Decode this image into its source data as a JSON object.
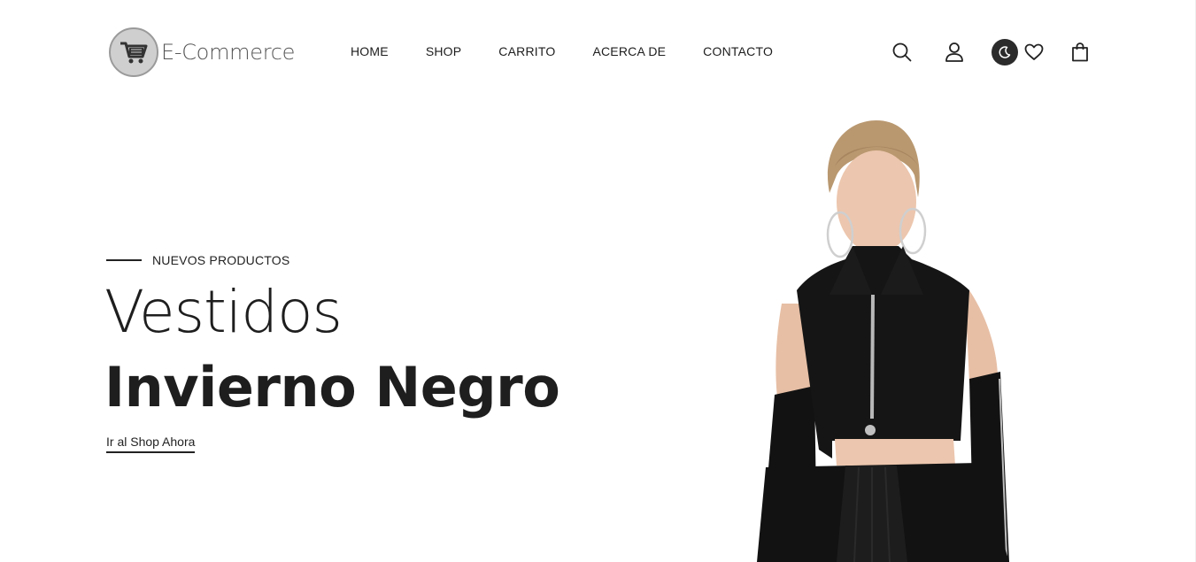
{
  "brand": {
    "name": "E-Commerce"
  },
  "nav": {
    "items": [
      {
        "label": "HOME"
      },
      {
        "label": "SHOP"
      },
      {
        "label": "CARRITO"
      },
      {
        "label": "ACERCA DE"
      },
      {
        "label": "CONTACTO"
      }
    ]
  },
  "header_icons": [
    "search-icon",
    "user-icon",
    "moon-icon",
    "heart-icon",
    "bag-icon"
  ],
  "hero": {
    "eyebrow": "NUEVOS PRODUCTOS",
    "title_light": "Vestidos",
    "title_bold": "Invierno Negro",
    "cta": "Ir al Shop Ahora"
  },
  "colors": {
    "text": "#1e1e1e",
    "background": "#ffffff",
    "dark_toggle": "#2b2b2b"
  }
}
